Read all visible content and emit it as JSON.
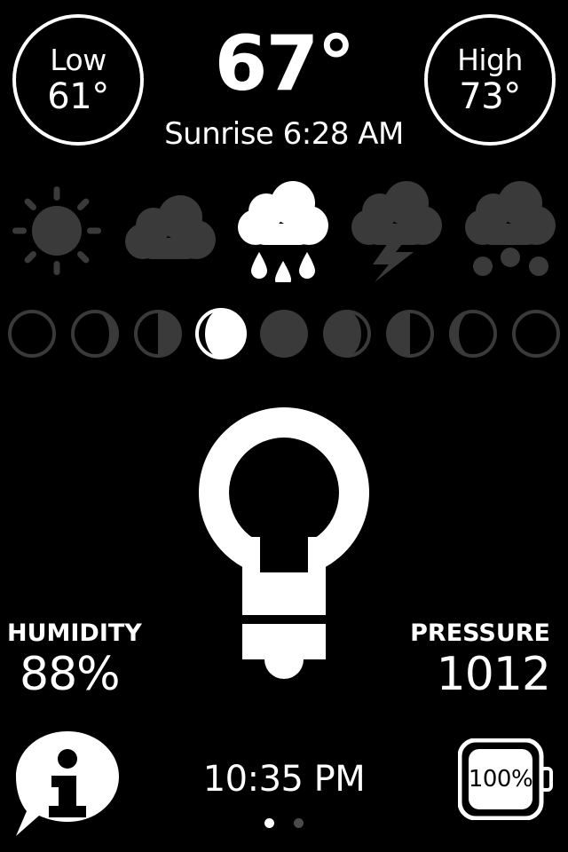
{
  "theme": {
    "background": "#000000",
    "foreground": "#ffffff",
    "icon_inactive": "#3a3a3a",
    "icon_active": "#ffffff",
    "dot_inactive": "#4a4a4a"
  },
  "header": {
    "low": {
      "label": "Low",
      "value": "61°"
    },
    "high": {
      "label": "High",
      "value": "73°"
    },
    "current_temperature": "67°",
    "sunrise": "Sunrise 6:28 AM"
  },
  "weather_icons": [
    {
      "name": "sun-icon",
      "label": "Clear",
      "selected": false
    },
    {
      "name": "cloud-icon",
      "label": "Cloudy",
      "selected": false
    },
    {
      "name": "rain-icon",
      "label": "Rain",
      "selected": true
    },
    {
      "name": "thunderstorm-icon",
      "label": "Thunderstorm",
      "selected": false
    },
    {
      "name": "snow-icon",
      "label": "Snow",
      "selected": false
    }
  ],
  "moon_phases": [
    {
      "name": "moon-new-icon",
      "label": "New Moon",
      "selected": false
    },
    {
      "name": "moon-waxing-crescent-icon",
      "label": "Waxing Crescent",
      "selected": false
    },
    {
      "name": "moon-first-quarter-icon",
      "label": "First Quarter",
      "selected": false
    },
    {
      "name": "moon-waxing-gibbous-icon",
      "label": "Waxing Gibbous",
      "selected": true
    },
    {
      "name": "moon-full-icon",
      "label": "Full Moon",
      "selected": false
    },
    {
      "name": "moon-waning-gibbous-icon",
      "label": "Waning Gibbous",
      "selected": false
    },
    {
      "name": "moon-last-quarter-icon",
      "label": "Last Quarter",
      "selected": false
    },
    {
      "name": "moon-waning-crescent-icon",
      "label": "Waning Crescent",
      "selected": false
    },
    {
      "name": "moon-new-end-icon",
      "label": "New Moon",
      "selected": false
    }
  ],
  "bulb": {
    "name": "lightbulb-icon",
    "state": "on"
  },
  "readouts": {
    "humidity": {
      "label": "HUMIDITY",
      "value": "88%"
    },
    "pressure": {
      "label": "PRESSURE",
      "value": "1012"
    }
  },
  "footer": {
    "info_button": "info-bubble-icon",
    "clock": "10:35 PM",
    "battery": {
      "level": "100%"
    },
    "page_dots": {
      "count": 2,
      "active_index": 0
    }
  }
}
